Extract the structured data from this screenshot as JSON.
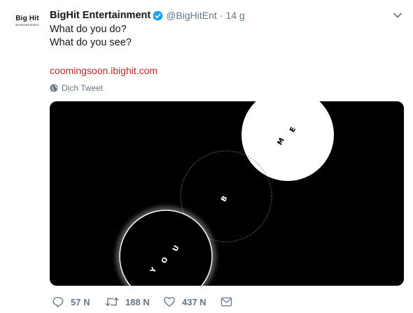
{
  "avatar": {
    "logo_main": "Big Hit",
    "logo_sub": "Entertainment"
  },
  "tweet": {
    "display_name": "BigHit Entertainment",
    "handle": "@BigHitEnt",
    "separator": "·",
    "time": "14 g",
    "line1": "What do you do?",
    "line2": "What do you see?",
    "link": "coomingsoon.ibighit.com",
    "translate_label": "Dịch Tweet"
  },
  "media": {
    "letters": {
      "me_m": "M",
      "me_e": "E",
      "b": "B",
      "you_y": "Y",
      "you_o": "O",
      "you_u": "U"
    }
  },
  "actions": {
    "replies": "57 N",
    "retweets": "188 N",
    "likes": "437 N"
  },
  "colors": {
    "link": "#b92b27",
    "verified": "#1da1f2",
    "muted": "#657786"
  }
}
